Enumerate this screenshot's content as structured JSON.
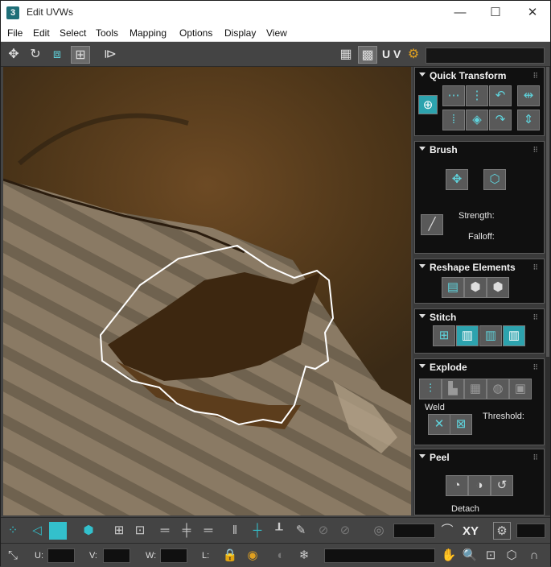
{
  "window": {
    "title": "Edit UVWs",
    "app_icon": "3",
    "minimize_glyph": "—",
    "maximize_glyph": "☐",
    "close_glyph": "✕"
  },
  "menu": [
    "File",
    "Edit",
    "Select",
    "Tools",
    "Mapping",
    "Options",
    "Display",
    "View"
  ],
  "toolbar": {
    "uv_label": "U V",
    "texture_dropdown_value": ""
  },
  "rollouts": {
    "quick_transform": {
      "title": "Quick Transform"
    },
    "brush": {
      "title": "Brush",
      "strength_label": "Strength:",
      "falloff_label": "Falloff:"
    },
    "reshape": {
      "title": "Reshape Elements"
    },
    "stitch": {
      "title": "Stitch"
    },
    "explode": {
      "title": "Explode",
      "weld_label": "Weld",
      "threshold_label": "Threshold:"
    },
    "peel": {
      "title": "Peel",
      "detach_label": "Detach"
    }
  },
  "status": {
    "u_label": "U:",
    "v_label": "V:",
    "w_label": "W:",
    "l_label": "L:",
    "xy_label": "XY",
    "u_value": "",
    "v_value": "",
    "w_value": ""
  },
  "colors": {
    "accent_teal": "#2da3ae",
    "panel_bg": "#101010",
    "ui_bg": "#444444"
  },
  "icons": {
    "move": "move-icon",
    "rotate": "rotate-icon",
    "scale": "scale-icon",
    "freeform": "freeform-icon",
    "mirror": "mirror-icon",
    "checker": "checker-icon",
    "checker_active": "checker-active-icon",
    "options": "options-icon"
  }
}
